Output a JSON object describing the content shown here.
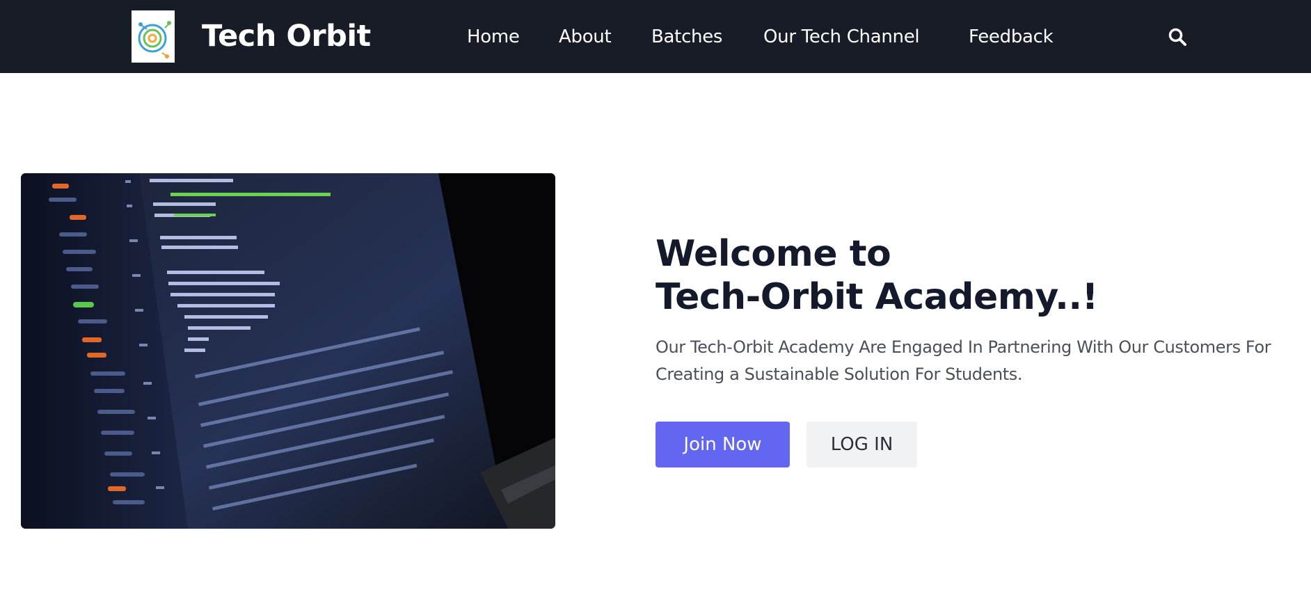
{
  "header": {
    "brand": "Tech Orbit",
    "logo_icon": "orbit-circuit-logo-icon",
    "nav": [
      {
        "label": "Home"
      },
      {
        "label": "About"
      },
      {
        "label": "Batches"
      },
      {
        "label": "Our Tech Channel"
      },
      {
        "label": "Feedback"
      }
    ],
    "search_icon": "search-icon"
  },
  "hero": {
    "image_description_icon": "laptop-code-image",
    "title_line1": "Welcome to",
    "title_line2": "Tech-Orbit Academy..!",
    "description_line1": "Our Tech-Orbit Academy Are Engaged In Partnering With Our Customers For",
    "description_line2": "Creating a Sustainable Solution For Students.",
    "join_label": "Join Now",
    "login_label": "LOG IN"
  },
  "colors": {
    "navbar_bg": "#181c26",
    "primary": "#6366f1",
    "secondary_btn": "#f1f2f4",
    "title_text": "#141a2b"
  }
}
